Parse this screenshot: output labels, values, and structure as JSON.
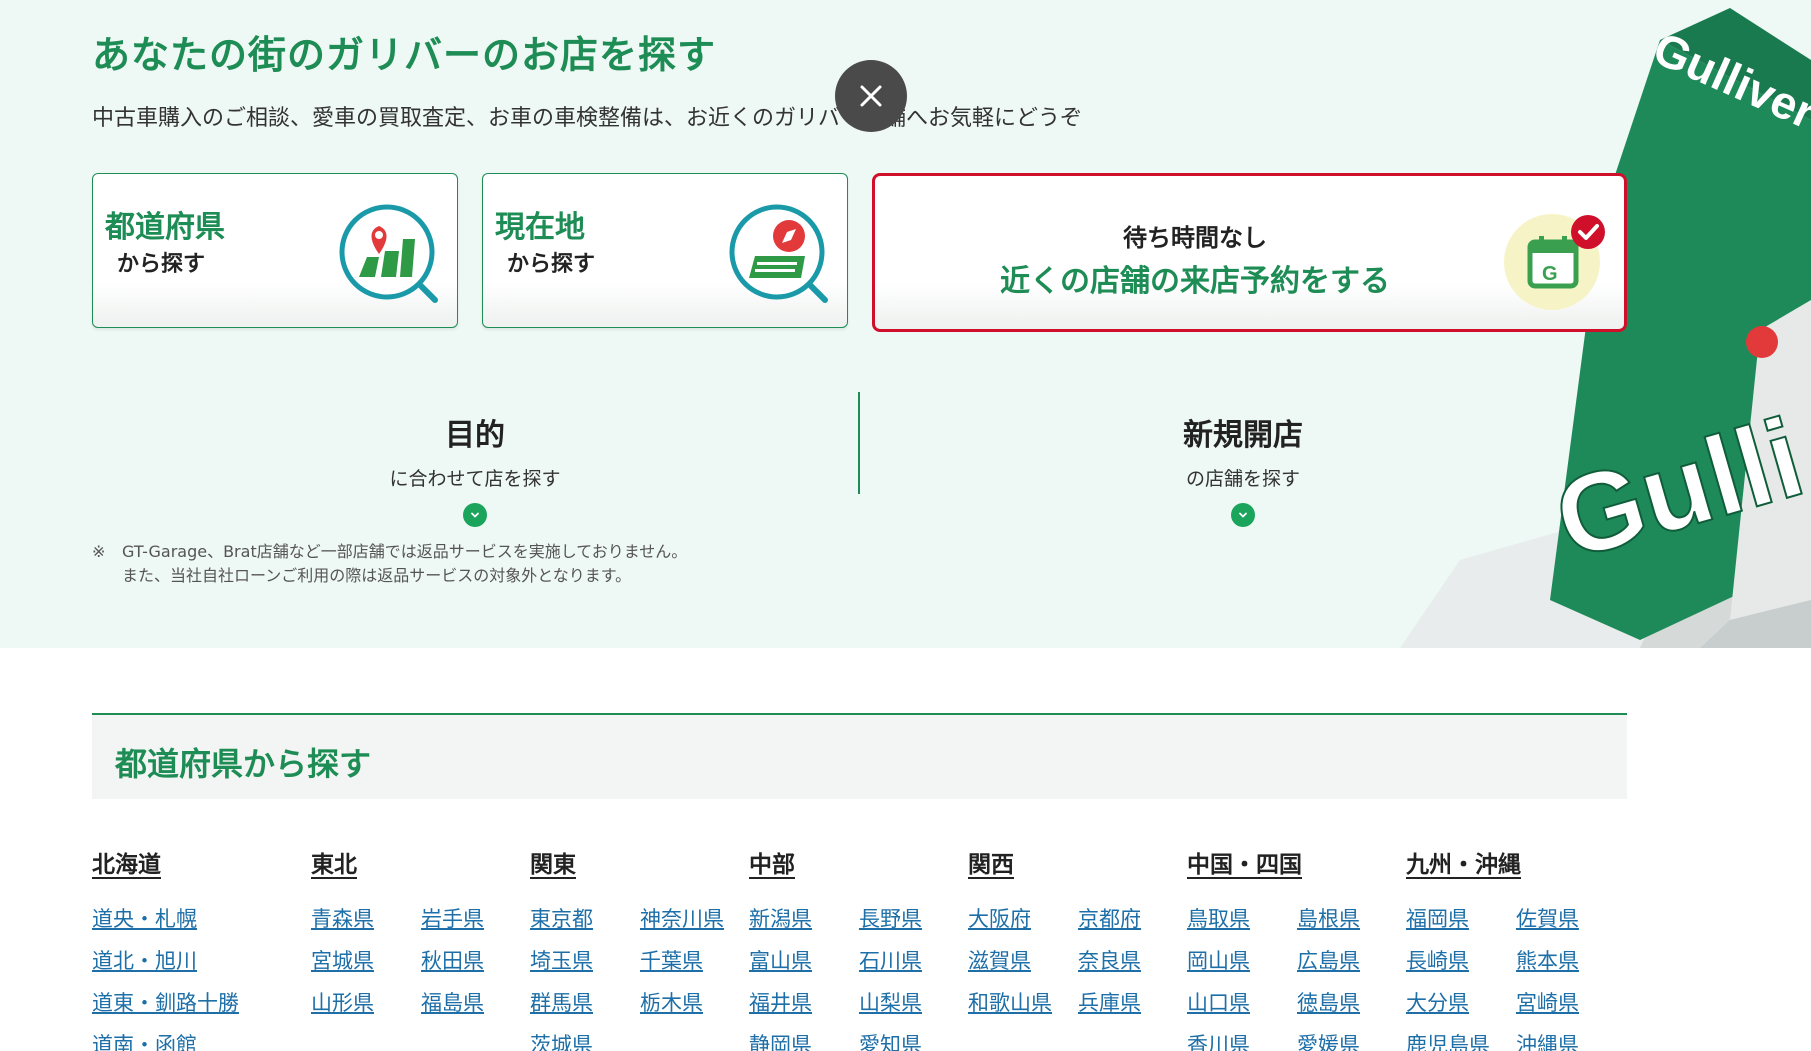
{
  "hero": {
    "title": "あなたの街のガリバーのお店を探す",
    "subtitle": "中古車購入のご相談、愛車の買取査定、お車の車検整備は、お近くのガリバー店舗へお気軽にどうぞ"
  },
  "cards": {
    "prefecture": {
      "title": "都道府県",
      "sub": "から探す"
    },
    "location": {
      "title": "現在地",
      "sub": "から探す"
    },
    "reserve": {
      "pre": "待ち時間なし",
      "main": "近くの店舗の来店予約をする"
    }
  },
  "purpose": {
    "title": "目的",
    "sub": "に合わせて店を探す"
  },
  "newstore": {
    "title": "新規開店",
    "sub": "の店舗を探す"
  },
  "note": {
    "mark": "※",
    "line1": "GT-Garage、Brat店舗など一部店舗では返品サービスを実施しておりません。",
    "line2": "また、当社自社ローンご利用の際は返品サービスの対象外となります。"
  },
  "prefecture_section": {
    "title": "都道府県から探す",
    "regions": [
      {
        "name": "北海道",
        "items": [
          "道央・札幌",
          "道北・旭川",
          "道東・釧路十勝",
          "道南・函館"
        ]
      },
      {
        "name": "東北",
        "items": [
          "青森県",
          "岩手県",
          "宮城県",
          "秋田県",
          "山形県",
          "福島県"
        ]
      },
      {
        "name": "関東",
        "items": [
          "東京都",
          "神奈川県",
          "埼玉県",
          "千葉県",
          "群馬県",
          "栃木県",
          "茨城県"
        ]
      },
      {
        "name": "中部",
        "items": [
          "新潟県",
          "長野県",
          "富山県",
          "石川県",
          "福井県",
          "山梨県",
          "静岡県",
          "愛知県"
        ]
      },
      {
        "name": "関西",
        "items": [
          "大阪府",
          "京都府",
          "滋賀県",
          "奈良県",
          "和歌山県",
          "兵庫県"
        ]
      },
      {
        "name": "中国・四国",
        "items": [
          "鳥取県",
          "島根県",
          "岡山県",
          "広島県",
          "山口県",
          "徳島県",
          "香川県",
          "愛媛県"
        ]
      },
      {
        "name": "九州・沖縄",
        "items": [
          "福岡県",
          "佐賀県",
          "長崎県",
          "熊本県",
          "大分県",
          "宮崎県",
          "鹿児島県",
          "沖縄県"
        ]
      }
    ]
  },
  "colors": {
    "brand_green": "#1d8c55",
    "reserve_border": "#d0102a",
    "link_blue": "#1e6fa8",
    "hero_bg": "#eef8f4"
  },
  "building_sign": "Gulliver"
}
